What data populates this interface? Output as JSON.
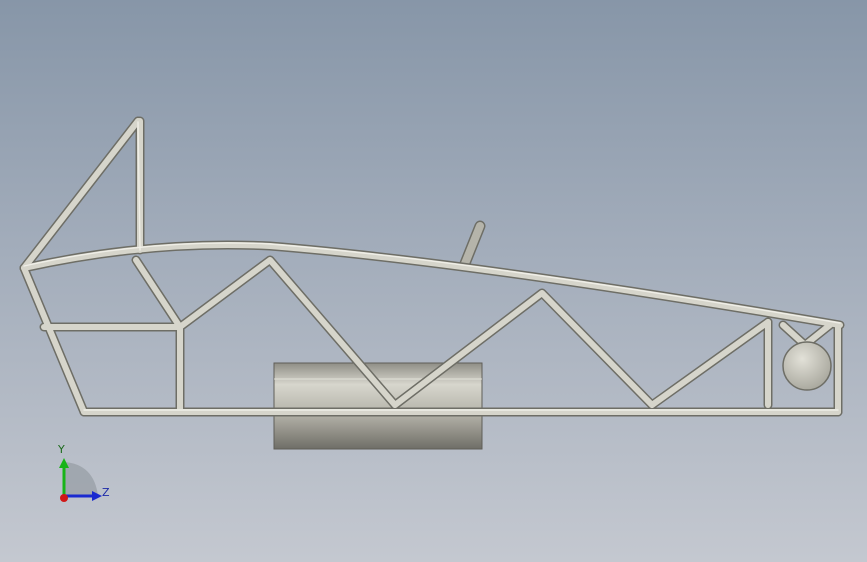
{
  "viewport": {
    "background_top": "#8796a8",
    "background_bottom": "#c4c8d0"
  },
  "model": {
    "description_icon": "tube-frame-chassis-model",
    "tube_color": "#c9c8bd",
    "tube_edge": "#6e6e66",
    "tank_color": "#b9b7ae"
  },
  "triad": {
    "y_label": "Y",
    "z_label": "Z",
    "y_color": "#18b418",
    "z_color": "#1a2ad0",
    "x_color": "#d01818"
  }
}
